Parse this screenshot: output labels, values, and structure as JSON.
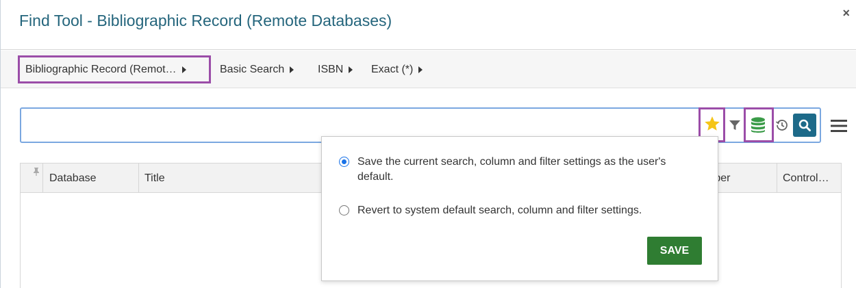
{
  "dialog": {
    "title": "Find Tool - Bibliographic Record (Remote Databases)",
    "close_label": "×"
  },
  "breadcrumbs": [
    {
      "label": "Bibliographic Record (Remot…"
    },
    {
      "label": "Basic Search"
    },
    {
      "label": "ISBN"
    },
    {
      "label": "Exact (*)"
    }
  ],
  "search": {
    "value": "",
    "placeholder": ""
  },
  "toolbar": {
    "icons": [
      "star-icon",
      "filter-icon",
      "database-icon",
      "history-icon",
      "search-icon",
      "menu-icon"
    ]
  },
  "grid": {
    "columns": [
      "Database",
      "Title",
      "mber",
      "Control…"
    ]
  },
  "popup": {
    "options": [
      {
        "label": "Save the current search, column and filter settings as the user's default.",
        "selected": true
      },
      {
        "label": "Revert to system default search, column and filter settings.",
        "selected": false
      }
    ],
    "save_label": "SAVE"
  },
  "colors": {
    "title": "#24657c",
    "highlight": "#9b4da8",
    "star": "#f5c518",
    "database": "#3a9b48",
    "search_button": "#1d6a89",
    "save_button": "#2f7d32",
    "radio_selected": "#1a73e8"
  }
}
